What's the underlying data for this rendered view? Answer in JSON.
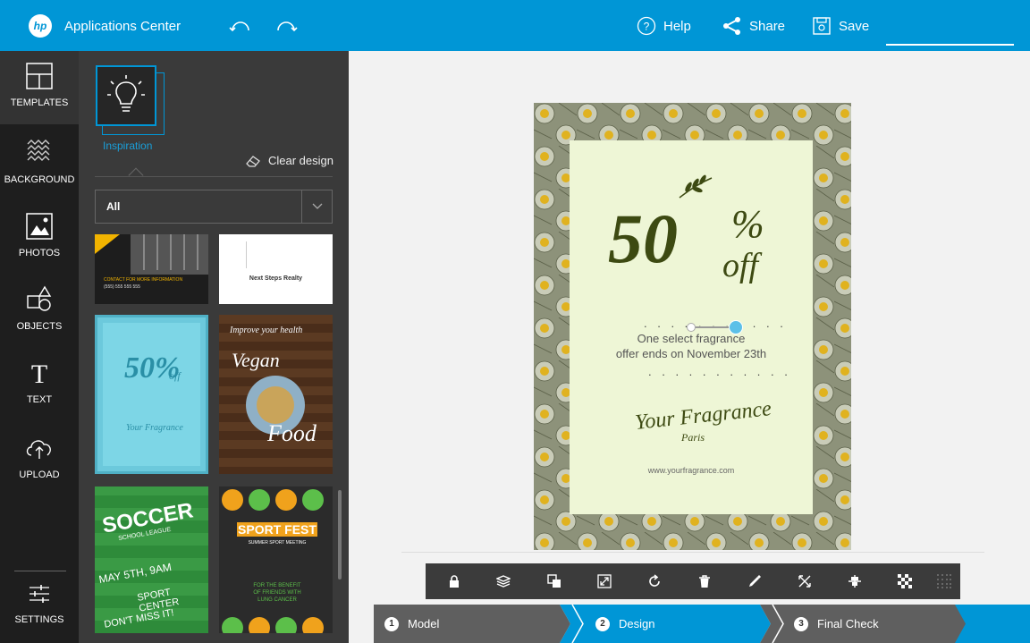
{
  "topbar": {
    "logo_text": "hp",
    "app_title": "Applications Center",
    "help_label": "Help",
    "share_label": "Share",
    "save_label": "Save"
  },
  "sidebar": {
    "items": [
      {
        "label": "TEMPLATES",
        "icon": "templates-icon"
      },
      {
        "label": "BACKGROUND",
        "icon": "background-icon"
      },
      {
        "label": "PHOTOS",
        "icon": "photos-icon"
      },
      {
        "label": "OBJECTS",
        "icon": "objects-icon"
      },
      {
        "label": "TEXT",
        "icon": "text-icon"
      },
      {
        "label": "UPLOAD",
        "icon": "upload-icon"
      },
      {
        "label": "SETTINGS",
        "icon": "settings-icon"
      }
    ]
  },
  "panel": {
    "inspiration_label": "Inspiration",
    "clear_label": "Clear design",
    "filter_value": "All",
    "thumbs": [
      {
        "name": "thumb-business",
        "lines": [
          "CONTACT FOR MORE INFORMATION",
          "(555) 555 555 555"
        ]
      },
      {
        "name": "thumb-realty",
        "lines": [
          "Next Steps Realty"
        ]
      },
      {
        "name": "thumb-50-off",
        "lines": [
          "50%",
          "off",
          "Your Fragrance"
        ]
      },
      {
        "name": "thumb-vegan",
        "lines": [
          "Improve your health",
          "Vegan",
          "Food"
        ]
      },
      {
        "name": "thumb-soccer",
        "lines": [
          "SOCCER",
          "SCHOOL LEAGUE",
          "MAY 5TH, 9AM",
          "SPORT CENTER",
          "DON'T MISS IT!"
        ]
      },
      {
        "name": "thumb-sportfest",
        "lines": [
          "SPORT FEST",
          "SUMMER SPORT MEETING",
          "FOR THE BENEFIT",
          "OF FRIENDS WITH",
          "LUNG CANCER"
        ]
      }
    ]
  },
  "flyer": {
    "big_number": "50",
    "percent": "%",
    "off": "off",
    "line1": "One select fragrance",
    "line2": "offer ends on November 23th",
    "brand": "Your Fragrance",
    "brand_sub": "Paris",
    "url": "www.yourfragrance.com",
    "dots": ". . . . . . . . . . ."
  },
  "toolbar": {
    "tools": [
      "lock-icon",
      "layers-icon",
      "duplicate-icon",
      "resize-icon",
      "rotate-icon",
      "delete-icon",
      "color-picker-icon",
      "flip-icon",
      "align-icon",
      "transparency-icon",
      "grid-icon"
    ]
  },
  "steps": [
    {
      "num": "1",
      "label": "Model"
    },
    {
      "num": "2",
      "label": "Design"
    },
    {
      "num": "3",
      "label": "Final Check"
    }
  ],
  "colors": {
    "accent": "#0096d6",
    "rail": "#1e1e1e",
    "panel": "#3a3a3a",
    "flyer_green": "#3d4a12",
    "flyer_bg": "#eef6d6"
  }
}
